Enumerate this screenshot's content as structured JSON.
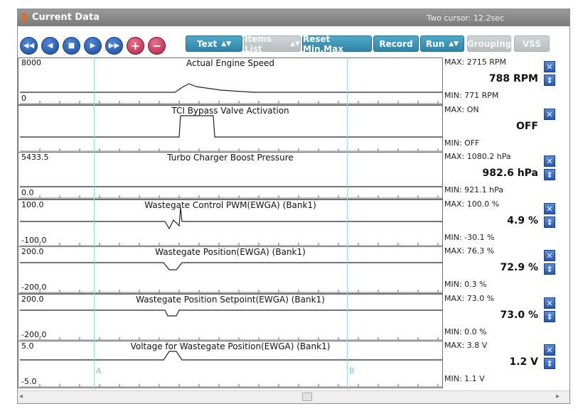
{
  "window": {
    "title": "Current Data",
    "cursor_readout": "Two cursor: 12.2sec"
  },
  "toolbar": {
    "nav_buttons": [
      {
        "name": "rewind-button",
        "icon": "◀◀"
      },
      {
        "name": "prev-button",
        "icon": "◀"
      },
      {
        "name": "stop-button",
        "icon": "■"
      },
      {
        "name": "play-button",
        "icon": "▶"
      },
      {
        "name": "fast-forward-button",
        "icon": "▶▶"
      },
      {
        "name": "zoom-in-button",
        "icon": "+"
      },
      {
        "name": "zoom-out-button",
        "icon": "−"
      }
    ],
    "text_label": "Text",
    "items_list_label": "Items List",
    "reset_label": "Reset Min.Max",
    "record_label": "Record",
    "run_label": "Run",
    "grouping_label": "Grouping",
    "vss_label": "VSS"
  },
  "cursors": {
    "a_label": "A",
    "b_label": "B"
  },
  "graphs": [
    {
      "title": "Actual Engine Speed",
      "axis_max": "8000",
      "axis_min": "0",
      "max_text": "MAX:  2715 RPM",
      "current_text": "788 RPM",
      "min_text": "MIN:  771 RPM",
      "has_spin": true
    },
    {
      "title": "TCI Bypass Valve Activation",
      "axis_max": "",
      "axis_min": "",
      "max_text": "MAX: ON",
      "current_text": "OFF",
      "min_text": "MIN: OFF",
      "has_spin": false
    },
    {
      "title": "Turbo Charger Boost Pressure",
      "axis_max": "5433.5",
      "axis_min": "0.0",
      "max_text": "MAX: 1080.2 hPa",
      "current_text": "982.6 hPa",
      "min_text": "MIN: 921.1 hPa",
      "has_spin": true
    },
    {
      "title": "Wastegate Control PWM(EWGA) (Bank1)",
      "axis_max": "100.0",
      "axis_min": "-100.0",
      "max_text": "MAX: 100.0 %",
      "current_text": "4.9 %",
      "min_text": "MIN: -30.1 %",
      "has_spin": true
    },
    {
      "title": "Wastegate Position(EWGA) (Bank1)",
      "axis_max": "200.0",
      "axis_min": "-200.0",
      "max_text": "MAX:  76.3 %",
      "current_text": "72.9 %",
      "min_text": "MIN:  0.3 %",
      "has_spin": true
    },
    {
      "title": "Wastegate Position Setpoint(EWGA) (Bank1)",
      "axis_max": "200.0",
      "axis_min": "-200.0",
      "max_text": "MAX:  73.0 %",
      "current_text": "73.0 %",
      "min_text": "MIN:  0.0 %",
      "has_spin": true
    },
    {
      "title": "Voltage for Wastegate Position(EWGA) (Bank1)",
      "axis_max": "5.0",
      "axis_min": "-5.0",
      "max_text": "MAX:   3.8 V",
      "current_text": "1.2 V",
      "min_text": "MIN:  1.1 V",
      "has_spin": true
    }
  ],
  "icons": {
    "close": "close-icon",
    "spin": "spin-arrows-icon"
  },
  "colors": {
    "toolbar_button": "#3a93b8",
    "nav_button": "#2b5fb0",
    "zoom_button": "#c8345c",
    "cursor_line": "#9fd6df"
  }
}
